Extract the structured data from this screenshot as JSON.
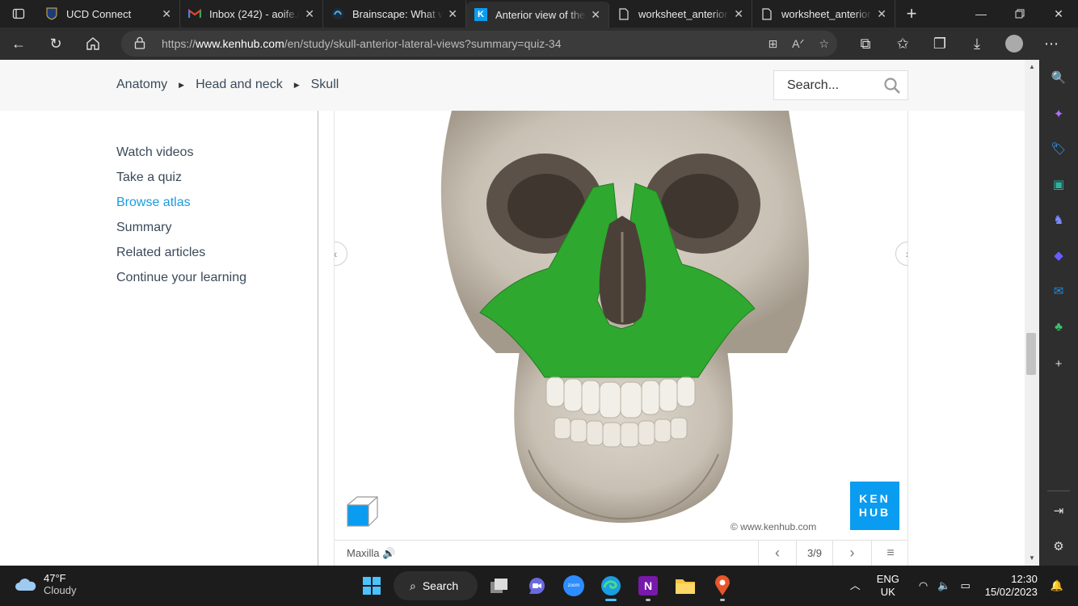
{
  "browser": {
    "tabs": [
      {
        "title": "UCD Connect",
        "icon": "ucd-shield-icon",
        "active": false
      },
      {
        "title": "Inbox (242) - aoife.c",
        "icon": "gmail-icon",
        "active": false
      },
      {
        "title": "Brainscape: What w",
        "icon": "brainscape-icon",
        "active": false
      },
      {
        "title": "Anterior view of the",
        "icon": "kenhub-k-icon",
        "active": true,
        "favicon_text": "K"
      },
      {
        "title": "worksheet_anterior_",
        "icon": "document-icon",
        "active": false
      },
      {
        "title": "worksheet_anterior_",
        "icon": "document-icon",
        "active": false
      }
    ],
    "url_prefix": "https://",
    "url_host": "www.kenhub.com",
    "url_path": "/en/study/skull-anterior-lateral-views?summary=quiz-34"
  },
  "site": {
    "breadcrumbs": [
      "Anatomy",
      "Head and neck",
      "Skull"
    ],
    "search_placeholder": "Search...",
    "nav": [
      {
        "label": "Watch videos",
        "active": false
      },
      {
        "label": "Take a quiz",
        "active": false
      },
      {
        "label": "Browse atlas",
        "active": true
      },
      {
        "label": "Summary",
        "active": false
      },
      {
        "label": "Related articles",
        "active": false
      },
      {
        "label": "Continue your learning",
        "active": false
      }
    ],
    "accent_color": "#1a9be0"
  },
  "viewer": {
    "structure_label": "Maxilla",
    "counter": "3/9",
    "logo_line1": "KEN",
    "logo_line2": "HUB",
    "copyright": "© www.kenhub.com",
    "highlight_color": "#2fa82f",
    "logo_color": "#0a9cf0"
  },
  "taskbar": {
    "temperature": "47°F",
    "condition": "Cloudy",
    "search_label": "Search",
    "lang_line1": "ENG",
    "lang_line2": "UK",
    "time": "12:30",
    "date": "15/02/2023"
  }
}
